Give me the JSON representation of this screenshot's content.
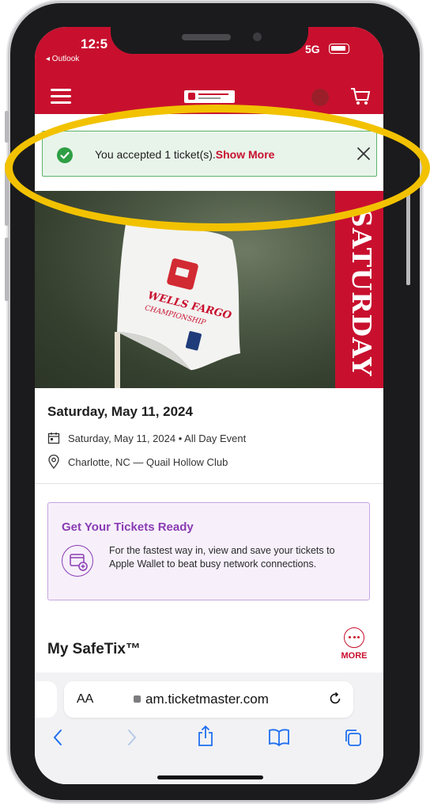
{
  "status": {
    "time": "12:5",
    "back_app": "◂ Outlook",
    "network": "5G"
  },
  "notification": {
    "message": "You accepted 1 ticket(s).",
    "link": "Show More",
    "close_icon": "close-icon"
  },
  "hero": {
    "flag_alt": "Wells Fargo Championship flag",
    "band_text": "SATURDAY",
    "colors": {
      "brand": "#c8102e"
    }
  },
  "event": {
    "title": "Saturday, May 11, 2024",
    "date_line": "Saturday, May 11, 2024 • All Day Event",
    "venue_line": "Charlotte, NC — Quail Hollow Club"
  },
  "ready": {
    "title": "Get Your Tickets Ready",
    "description": "For the fastest way in, view and save your tickets to Apple Wallet to beat busy network connections."
  },
  "safetix": {
    "heading": "My SafeTix™",
    "more_label": "MORE"
  },
  "safari": {
    "aa_label": "AA",
    "url": "am.ticketmaster.com"
  }
}
